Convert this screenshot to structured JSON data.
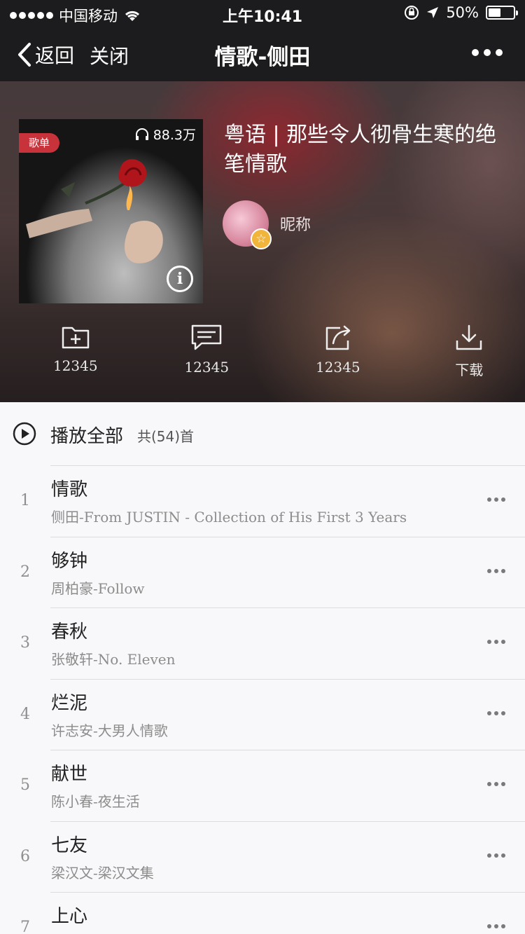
{
  "status_bar": {
    "carrier": "中国移动",
    "time": "上午10:41",
    "battery": "50%"
  },
  "nav": {
    "back_label": "返回",
    "close_label": "关闭",
    "title": "情歌-侧田"
  },
  "playlist": {
    "tag": "歌单",
    "plays": "88.3万",
    "title": "粤语 | 那些令人彻骨生寒的绝笔情歌",
    "creator_name": "昵称"
  },
  "actions": [
    {
      "icon": "folder-add-icon",
      "label": "12345"
    },
    {
      "icon": "comment-icon",
      "label": "12345"
    },
    {
      "icon": "share-icon",
      "label": "12345"
    },
    {
      "icon": "download-icon",
      "label": "下载"
    }
  ],
  "play_all": {
    "label": "播放全部",
    "count": "共(54)首"
  },
  "songs": [
    {
      "index": "1",
      "title": "情歌",
      "subtitle": "侧田-From JUSTIN - Collection of His First 3 Years"
    },
    {
      "index": "2",
      "title": "够钟",
      "subtitle": "周柏豪-Follow"
    },
    {
      "index": "3",
      "title": "春秋",
      "subtitle": "张敬轩-No. Eleven"
    },
    {
      "index": "4",
      "title": "烂泥",
      "subtitle": "许志安-大男人情歌"
    },
    {
      "index": "5",
      "title": "献世",
      "subtitle": "陈小春-夜生活"
    },
    {
      "index": "6",
      "title": "七友",
      "subtitle": "梁汉文-梁汉文集"
    },
    {
      "index": "7",
      "title": "上心",
      "subtitle": ""
    }
  ],
  "colors": {
    "tag_red": "#c8323a",
    "badge_gold": "#f2b53b",
    "nav_bg": "#1c1c1e"
  }
}
